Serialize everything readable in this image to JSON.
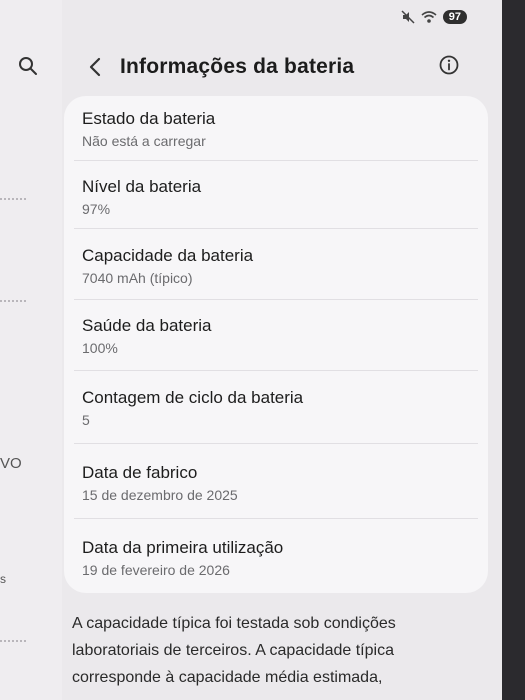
{
  "status_bar": {
    "battery_level": "97",
    "icons": [
      "mute-icon",
      "wifi-icon"
    ]
  },
  "header": {
    "title": "Informações da bateria",
    "back_icon": "chevron-left-icon",
    "info_icon": "info-icon"
  },
  "left_pane": {
    "search_icon": "search-icon",
    "fragments": [
      "VO",
      "s"
    ]
  },
  "battery_info": {
    "rows": [
      {
        "label": "Estado da bateria",
        "value": "Não está a carregar"
      },
      {
        "label": "Nível da bateria",
        "value": "97%"
      },
      {
        "label": "Capacidade da bateria",
        "value": "7040 mAh (típico)"
      },
      {
        "label": "Saúde da bateria",
        "value": "100%"
      },
      {
        "label": "Contagem de ciclo da bateria",
        "value": "5"
      },
      {
        "label": "Data de fabrico",
        "value": "15 de dezembro de 2025"
      },
      {
        "label": "Data da primeira utilização",
        "value": "19 de fevereiro de 2026"
      }
    ]
  },
  "footnote": {
    "text": "A capacidade típica foi testada sob condições laboratoriais de terceiros. A capacidade típica corresponde à capacidade média estimada,"
  }
}
